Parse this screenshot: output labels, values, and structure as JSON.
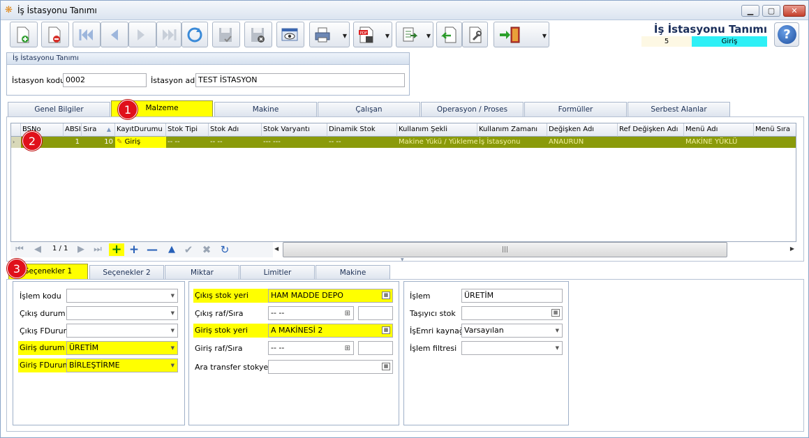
{
  "window": {
    "title": "İş İstasyonu Tanımı"
  },
  "header": {
    "title": "İş İstasyonu Tanımı",
    "record_no": "5",
    "status": "Giriş"
  },
  "group": {
    "title": "İş İstasyonu Tanımı",
    "code_label": "İstasyon kodu",
    "code_value": "0002",
    "name_label": "İstasyon adı",
    "name_value": "TEST İSTASYON"
  },
  "main_tabs": [
    "Genel Bilgiler",
    "Malzeme",
    "Makine",
    "Çalışan",
    "Operasyon / Proses",
    "Formüller",
    "Serbest Alanlar"
  ],
  "grid": {
    "columns": [
      "BSNo",
      "ABSI",
      "Sıra",
      "KayıtDurumu",
      "Stok Tipi",
      "Stok Adı",
      "Stok Varyantı",
      "Dinamik Stok",
      "Kullanım Şekli",
      "Kullanım Zamanı",
      "Değişken Adı",
      "Ref Değişken Adı",
      "Menü Adı",
      "Menü Sıra"
    ],
    "row": [
      "",
      "1",
      "10",
      "Giriş",
      "-- --",
      "-- --",
      "--- ---",
      "-- --",
      "Makine Yükü / Yükleme",
      "İş İstasyonu",
      "ANAURUN",
      "",
      "MAKİNE YÜKLÜ",
      ""
    ]
  },
  "nav": {
    "page": "1 / 1"
  },
  "sub_tabs": [
    "Seçenekler 1",
    "Seçenekler 2",
    "Miktar",
    "Limitler",
    "Makine"
  ],
  "form1": {
    "islem_kodu": {
      "label": "İşlem kodu",
      "value": ""
    },
    "cikis_durum": {
      "label": "Çıkış durum",
      "value": ""
    },
    "cikis_fdurum": {
      "label": "Çıkış FDurum",
      "value": ""
    },
    "giris_durum": {
      "label": "Giriş durum",
      "value": "ÜRETİM"
    },
    "giris_fdurum": {
      "label": "Giriş FDurum",
      "value": "BİRLEŞTİRME"
    }
  },
  "form2": {
    "cikis_stok_yeri": {
      "label": "Çıkış stok yeri",
      "value": "HAM MADDE DEPO"
    },
    "cikis_raf": {
      "label": "Çıkış raf/Sıra",
      "value": "-- --"
    },
    "giris_stok_yeri": {
      "label": "Giriş stok yeri",
      "value": "A MAKİNESİ 2"
    },
    "giris_raf": {
      "label": "Giriş raf/Sıra",
      "value": "-- --"
    },
    "ara_transfer": {
      "label": "Ara transfer stokyeri",
      "value": ""
    }
  },
  "form3": {
    "islem": {
      "label": "İşlem",
      "value": "ÜRETİM"
    },
    "tasiyici": {
      "label": "Taşıyıcı stok",
      "value": ""
    },
    "isemri": {
      "label": "İşEmri kaynağı",
      "value": "Varsayılan"
    },
    "filtre": {
      "label": "İşlem filtresi",
      "value": ""
    }
  },
  "badges": [
    "1",
    "2",
    "3"
  ],
  "colors": {
    "highlight": "#ffff00",
    "row_selected": "#8a9a0a",
    "status_cyan": "#2ef0f6"
  }
}
